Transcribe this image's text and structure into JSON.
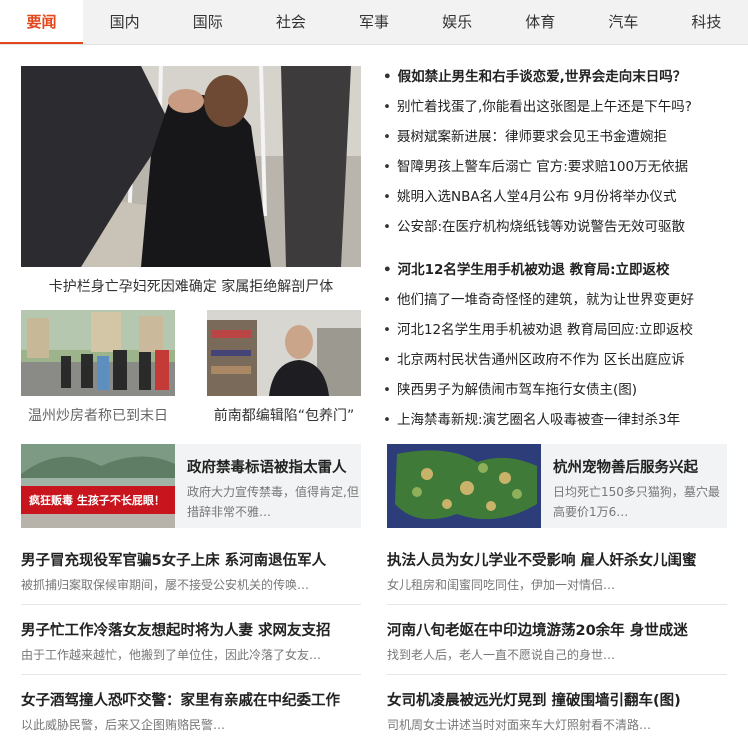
{
  "tabs": [
    "要闻",
    "国内",
    "国际",
    "社会",
    "军事",
    "娱乐",
    "体育",
    "汽车",
    "科技"
  ],
  "feature": {
    "main_caption": "卡护栏身亡孕妇死因难确定 家属拒绝解剖尸体",
    "small1_caption": "温州炒房者称已到末日",
    "small2_caption": "前南都编辑陷“包养门”"
  },
  "headlines": [
    {
      "text": "假如禁止男生和右手谈恋爱,世界会走向末日吗？",
      "bold": true
    },
    {
      "text": "别忙着找蛋了,你能看出这张图是上午还是下午吗?",
      "bold": false
    },
    {
      "text": "聂树斌案新进展：律师要求会见王书金遭婉拒",
      "bold": false
    },
    {
      "text": "智障男孩上警车后溺亡 官方:要求赔100万无依据",
      "bold": false
    },
    {
      "text": "姚明入选NBA名人堂4月公布 9月份将举办仪式",
      "bold": false
    },
    {
      "text": "公安部:在医疗机构烧纸钱等劝说警告无效可驱散",
      "bold": false
    },
    {
      "text": "河北12名学生用手机被劝退 教育局:立即返校",
      "bold": true
    },
    {
      "text": "他们搞了一堆奇奇怪怪的建筑，就为让世界变更好",
      "bold": false
    },
    {
      "text": "河北12名学生用手机被劝退 教育局回应:立即返校",
      "bold": false
    },
    {
      "text": "北京两村民状告通州区政府不作为 区长出庭应诉",
      "bold": false
    },
    {
      "text": "陕西男子为解债闹市驾车拖行女债主(图)",
      "bold": false
    },
    {
      "text": "上海禁毒新规:演艺圈名人吸毒被查一律封杀3年",
      "bold": false
    }
  ],
  "cards": [
    {
      "title": "政府禁毒标语被指太雷人",
      "desc": "政府大力宣传禁毒，值得肯定,但措辞非常不雅…",
      "banner": "疯狂贩毒 生孩子不长屁眼！"
    },
    {
      "title": "杭州宠物善后服务兴起",
      "desc": "日均死亡150多只猫狗，墓穴最高要价1万6…"
    }
  ],
  "items": [
    {
      "title": "男子冒充现役军官骗5女子上床 系河南退伍军人",
      "desc": "被抓捕归案取保候审期间，屡不接受公安机关的传唤…"
    },
    {
      "title": "执法人员为女儿学业不受影响 雇人奸杀女儿闺蜜",
      "desc": "女儿租房和闺蜜同吃同住，伊加一对情侣…"
    },
    {
      "title": "男子忙工作冷落女友想起时将为人妻 求网友支招",
      "desc": "由于工作越来越忙，他搬到了单位住，因此冷落了女友…"
    },
    {
      "title": "河南八旬老妪在中印边境游荡20余年 身世成迷",
      "desc": "找到老人后，老人一直不愿说自己的身世…"
    },
    {
      "title": "女子酒驾撞人恐吓交警：家里有亲戚在中纪委工作",
      "desc": "以此威胁民警，后来又企图贿赂民警…"
    },
    {
      "title": "女司机凌晨被远光灯晃到 撞破围墙引翻车(图)",
      "desc": "司机周女士讲述当时对面来车大灯照射看不清路…"
    }
  ],
  "colors": {
    "accent": "#e2471d",
    "banner_red": "#c8141c"
  }
}
